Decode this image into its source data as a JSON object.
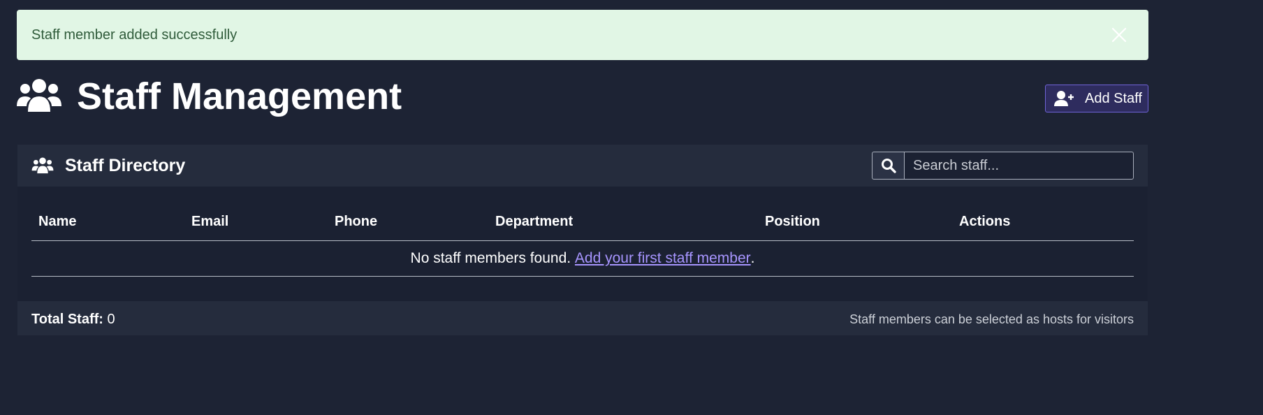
{
  "alert": {
    "message": "Staff member added successfully"
  },
  "header": {
    "title": "Staff Management",
    "add_button_label": "Add Staff"
  },
  "card": {
    "title": "Staff Directory",
    "search": {
      "placeholder": "Search staff..."
    },
    "columns": [
      "Name",
      "Email",
      "Phone",
      "Department",
      "Position",
      "Actions"
    ],
    "empty": {
      "text": "No staff members found. ",
      "link": "Add your first staff member",
      "suffix": "."
    },
    "footer": {
      "total_label": "Total Staff:",
      "total_value": " 0",
      "note": "Staff members can be selected as hosts for visitors"
    }
  },
  "colors": {
    "background": "#1d2334",
    "alert_bg": "#e1f6e5",
    "accent": "#6f63d8",
    "link": "#a795ff"
  },
  "icons": [
    "close-icon",
    "users-icon",
    "user-plus-icon",
    "search-icon"
  ]
}
